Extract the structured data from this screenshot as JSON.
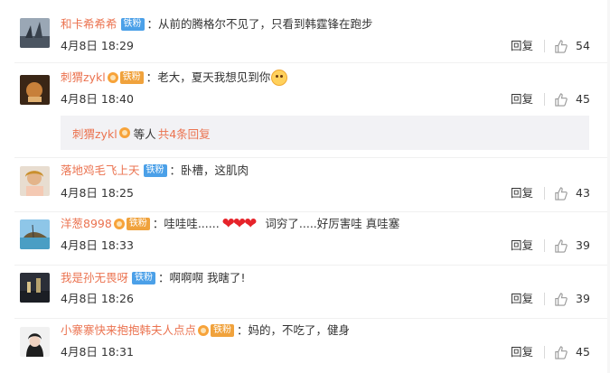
{
  "comments": [
    {
      "user": "和卡希希希",
      "badge": "铁粉",
      "vip": false,
      "sep": "：",
      "text": "从前的腾格尔不见了，只看到韩霆锋在跑步",
      "time": "4月8日 18:29",
      "reply": "回复",
      "likes": "54"
    },
    {
      "user": "刺猬zykl",
      "badge": "铁粉",
      "vip": true,
      "sep": "：",
      "text": "老大，夏天我想见到你",
      "time": "4月8日 18:40",
      "reply": "回复",
      "likes": "45"
    },
    {
      "user": "落地鸡毛飞上天",
      "badge": "铁粉",
      "vip": false,
      "sep": "：",
      "text": "卧槽，这肌肉",
      "time": "4月8日 18:25",
      "reply": "回复",
      "likes": "43"
    },
    {
      "user": "洋葱8998",
      "badge": "铁粉",
      "vip": true,
      "sep": "：",
      "text_before": "哇哇哇......",
      "hearts": "❤❤❤",
      "text_after": "词穷了.....好厉害哇 真哇塞",
      "time": "4月8日 18:33",
      "reply": "回复",
      "likes": "39"
    },
    {
      "user": "我是孙无畏呀",
      "badge": "铁粉",
      "vip": false,
      "sep": "：",
      "text": "啊啊啊 我瞎了!",
      "time": "4月8日 18:26",
      "reply": "回复",
      "likes": "39"
    },
    {
      "user": "小寨寨快来抱抱韩夫人点点",
      "badge": "铁粉",
      "vip": true,
      "sep": "：",
      "text": "妈的，不吃了，健身",
      "time": "4月8日 18:31",
      "reply": "回复",
      "likes": "45"
    }
  ],
  "sub_reply": {
    "user": "刺猬zykl",
    "others": "等人",
    "count_link": "共4条回复"
  },
  "colors": {
    "username": "#eb7350",
    "badge_blue": "#4ba0e8",
    "badge_orange": "#f0a23c",
    "reply_box": "#f2f2f5"
  }
}
